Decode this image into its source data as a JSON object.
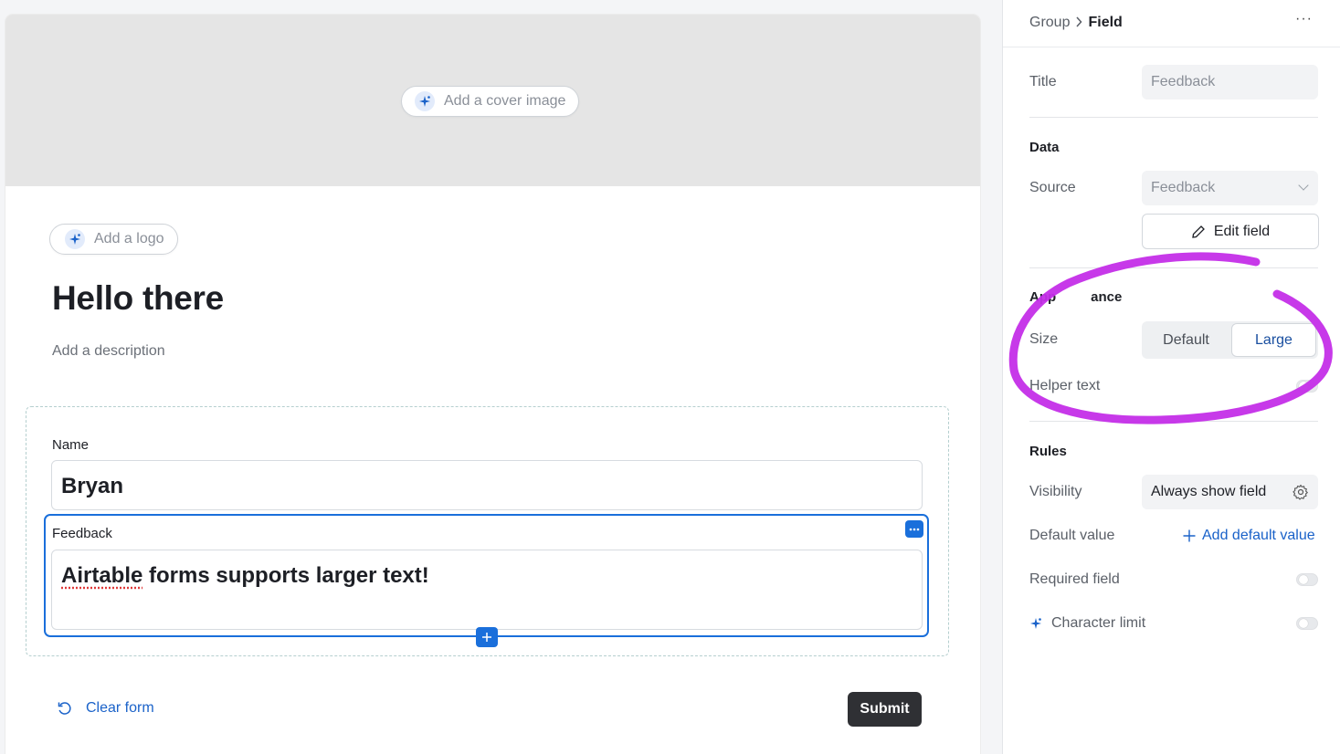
{
  "form": {
    "cover_button": "Add a cover image",
    "logo_button": "Add a logo",
    "title": "Hello there",
    "description_placeholder": "Add a description",
    "fields": {
      "name": {
        "label": "Name",
        "value": "Bryan"
      },
      "feedback": {
        "label": "Feedback",
        "value_word1": "Airtable",
        "value_rest": " forms supports larger text!"
      }
    },
    "clear_form": "Clear form",
    "submit": "Submit"
  },
  "panel": {
    "breadcrumb": {
      "parent": "Group",
      "current": "Field"
    },
    "more": "···",
    "title": {
      "label": "Title",
      "value": "Feedback"
    },
    "data": {
      "heading": "Data",
      "source_label": "Source",
      "source_value": "Feedback",
      "edit_field": "Edit field"
    },
    "appearance": {
      "heading_left": "App",
      "heading_right": "ance",
      "size_label": "Size",
      "size_options": [
        "Default",
        "Large"
      ],
      "size_selected": "Large",
      "helper_text_label": "Helper text",
      "helper_text_enabled": false
    },
    "rules": {
      "heading": "Rules",
      "visibility_label": "Visibility",
      "visibility_value": "Always show field",
      "default_value_label": "Default value",
      "add_default_value": "Add default value",
      "required_field_label": "Required field",
      "required_field_enabled": false,
      "character_limit_label": "Character limit",
      "character_limit_enabled": false
    }
  },
  "colors": {
    "accent_blue": "#1a6fdb",
    "annotation_magenta": "#c42ee8",
    "submit_bg": "#2f3034",
    "cover_bg": "#e5e5e5"
  }
}
